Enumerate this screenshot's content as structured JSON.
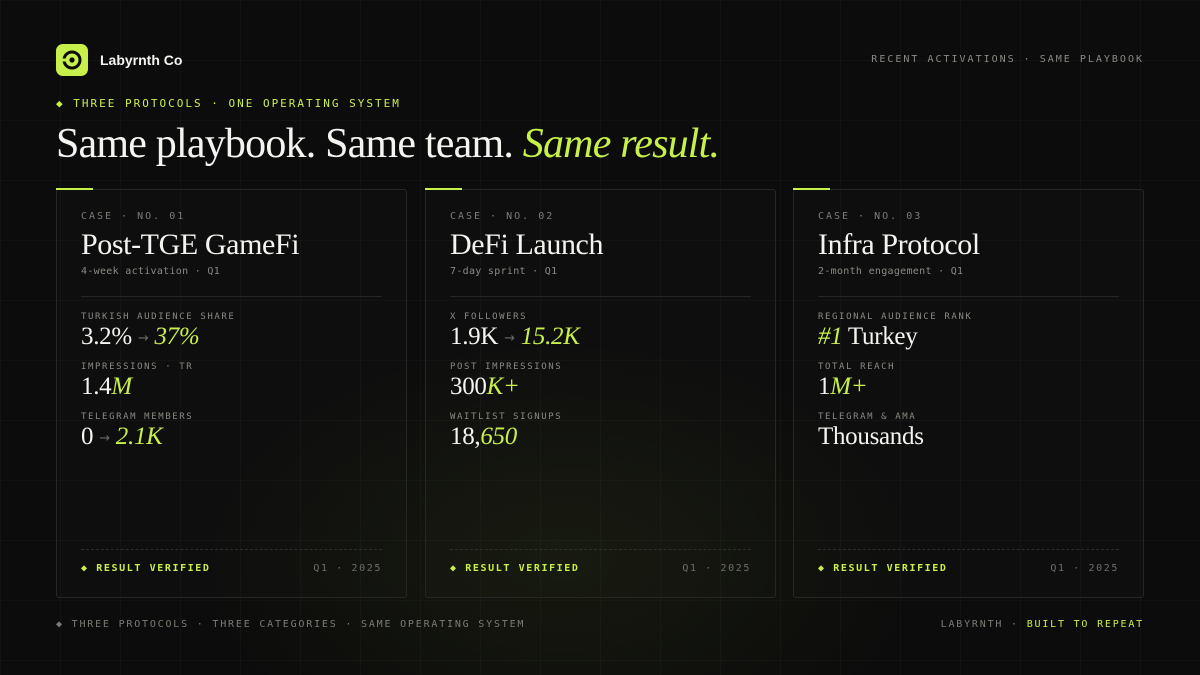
{
  "header": {
    "brand": "Labyrnth Co",
    "logo_icon": "labyrinth-logo-icon",
    "top_right": "RECENT ACTIVATIONS · SAME PLAYBOOK",
    "eyebrow": "◆ THREE PROTOCOLS · ONE OPERATING SYSTEM",
    "headline_main": "Same playbook. Same team. ",
    "headline_accent": "Same result."
  },
  "colors": {
    "accent": "#c8f04a",
    "background": "#0c0c0c",
    "card_border": "#262626"
  },
  "cards": [
    {
      "case": "CASE · NO. 01",
      "title": "Post-TGE GameFi",
      "subtitle": "4-week activation · Q1",
      "metrics": [
        {
          "label": "TURKISH AUDIENCE SHARE",
          "from": "3.2%",
          "arrow": "→",
          "to": "37%"
        },
        {
          "label": "IMPRESSIONS · TR",
          "plain": "1.4",
          "accent": "M"
        },
        {
          "label": "TELEGRAM MEMBERS",
          "from": "0",
          "arrow": "→",
          "to": "2.1K"
        }
      ],
      "verified": "◆ RESULT VERIFIED",
      "period": "Q1 · 2025"
    },
    {
      "case": "CASE · NO. 02",
      "title": "DeFi Launch",
      "subtitle": "7-day sprint · Q1",
      "metrics": [
        {
          "label": "X FOLLOWERS",
          "from": "1.9K",
          "arrow": "→",
          "to": "15.2K"
        },
        {
          "label": "POST IMPRESSIONS",
          "plain": "300",
          "accent": "K+"
        },
        {
          "label": "WAITLIST SIGNUPS",
          "plain": "18,",
          "accent": "650"
        }
      ],
      "verified": "◆ RESULT VERIFIED",
      "period": "Q1 · 2025"
    },
    {
      "case": "CASE · NO. 03",
      "title": "Infra Protocol",
      "subtitle": "2-month engagement · Q1",
      "metrics": [
        {
          "label": "REGIONAL AUDIENCE RANK",
          "accent": "#1",
          "rest": " Turkey"
        },
        {
          "label": "TOTAL REACH",
          "plain": "1",
          "accent": "M+"
        },
        {
          "label": "TELEGRAM & AMA",
          "plain": "Thousands"
        }
      ],
      "verified": "◆ RESULT VERIFIED",
      "period": "Q1 · 2025"
    }
  ],
  "footer": {
    "left": "◆ THREE PROTOCOLS · THREE CATEGORIES · SAME OPERATING SYSTEM",
    "right_brand": "LABYRNTH",
    "right_sep": " · ",
    "right_accent": "BUILT TO REPEAT"
  }
}
